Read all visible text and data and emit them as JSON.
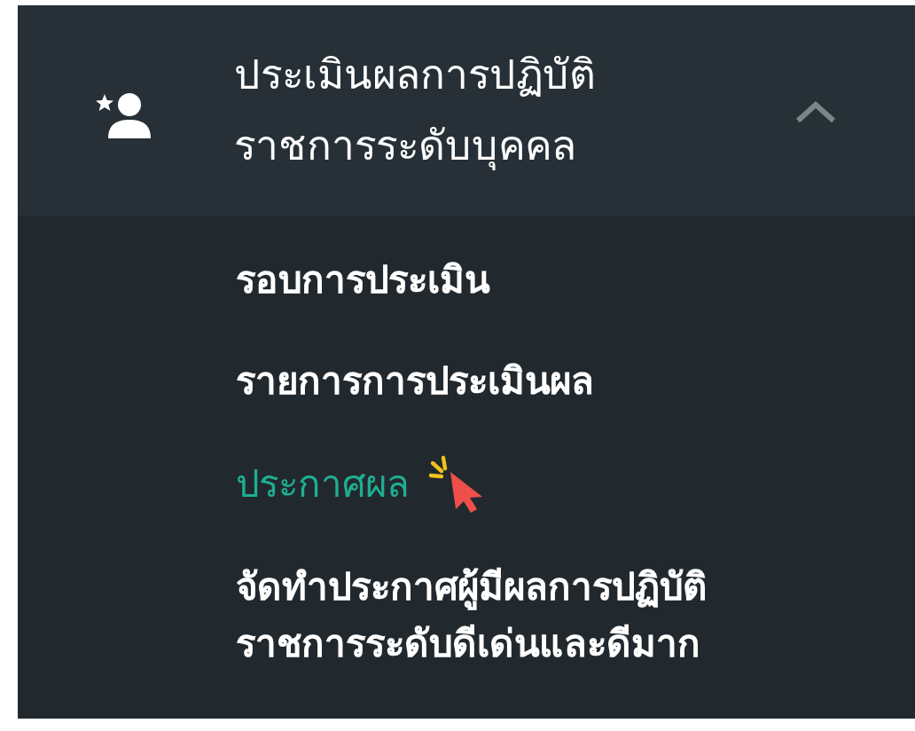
{
  "menu_group": {
    "title_lines": [
      "ประเมินผลการปฏิบัติ",
      "ราชการระดับบุคคล"
    ],
    "expanded": true,
    "items": [
      {
        "label_lines": [
          "รอบการประเมิน"
        ],
        "selected": false
      },
      {
        "label_lines": [
          "รายการการประเมินผล"
        ],
        "selected": false
      },
      {
        "label_lines": [
          "ประกาศผล"
        ],
        "selected": true
      },
      {
        "label_lines": [
          "จัดทำประกาศผู้มีผลการปฏิบัติ",
          "ราชการระดับดีเด่นและดีมาก"
        ],
        "selected": false
      }
    ]
  }
}
